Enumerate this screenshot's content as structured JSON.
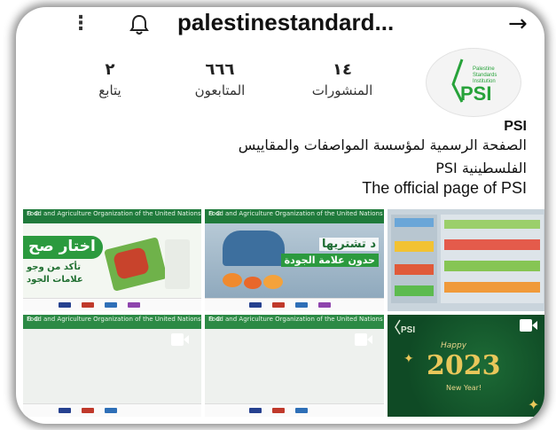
{
  "header": {
    "username": "palestinestandard...",
    "kebab": "⋮",
    "back_arrow": "→"
  },
  "profile": {
    "logo": {
      "brand": "PSI",
      "caption_lines": [
        "Palestine",
        "Standards",
        "Institution"
      ],
      "brand_color": "#27a23a"
    },
    "stats": [
      {
        "value": "١٤",
        "label": "المنشورات"
      },
      {
        "value": "٦٦٦",
        "label": "المتابعون"
      },
      {
        "value": "٢",
        "label": "يتابع"
      }
    ],
    "name": "PSI",
    "bio_lines": [
      "الصفحة الرسمية لمؤسسة المواصفات والمقاييس",
      "الفلسطينية PSI",
      "The official page of PSI"
    ]
  },
  "posts": {
    "tile1_headline": "اختار صح",
    "tile1_sub1": "تأكد من وجو",
    "tile1_sub2": "علامات الجود",
    "tile2_line1": "د تشتريها",
    "tile2_line2": "حدون علامة الجودة",
    "tile9_happy": "Happy",
    "tile9_year": "2023",
    "tile9_newyear": "New Year!",
    "fao_text": "Food and Agriculture Organization of the United Nations"
  },
  "colors": {
    "accent_green": "#27a23a",
    "gov_green": "#1f7a3b",
    "dark_green_card": "#0f4a25"
  }
}
